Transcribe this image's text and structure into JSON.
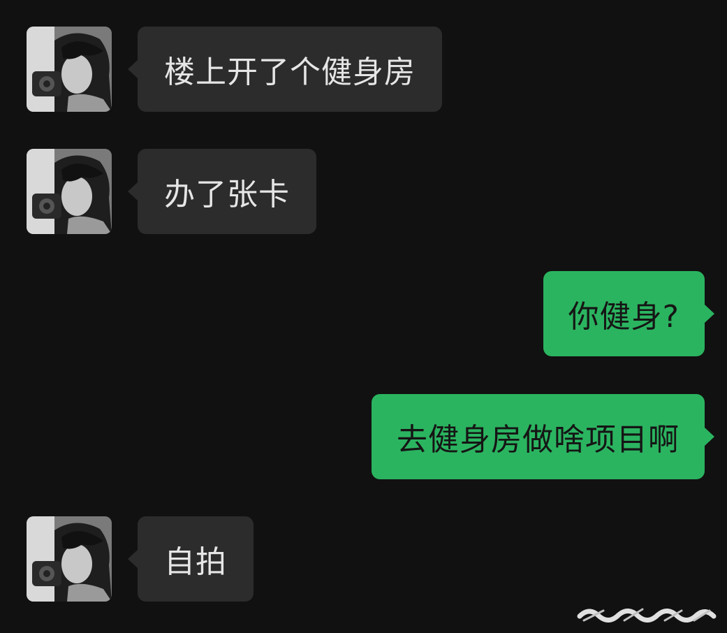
{
  "messages": [
    {
      "side": "in",
      "text": "楼上开了个健身房"
    },
    {
      "side": "in",
      "text": "办了张卡"
    },
    {
      "side": "out",
      "text": "你健身?"
    },
    {
      "side": "out",
      "text": "去健身房做啥项目啊"
    },
    {
      "side": "in",
      "text": "自拍"
    }
  ],
  "colors": {
    "background": "#111111",
    "incoming_bubble": "#2c2c2c",
    "outgoing_bubble": "#2bb460"
  },
  "icons": {
    "avatar": "user-avatar-photo",
    "watermark": "watermark-logo"
  }
}
